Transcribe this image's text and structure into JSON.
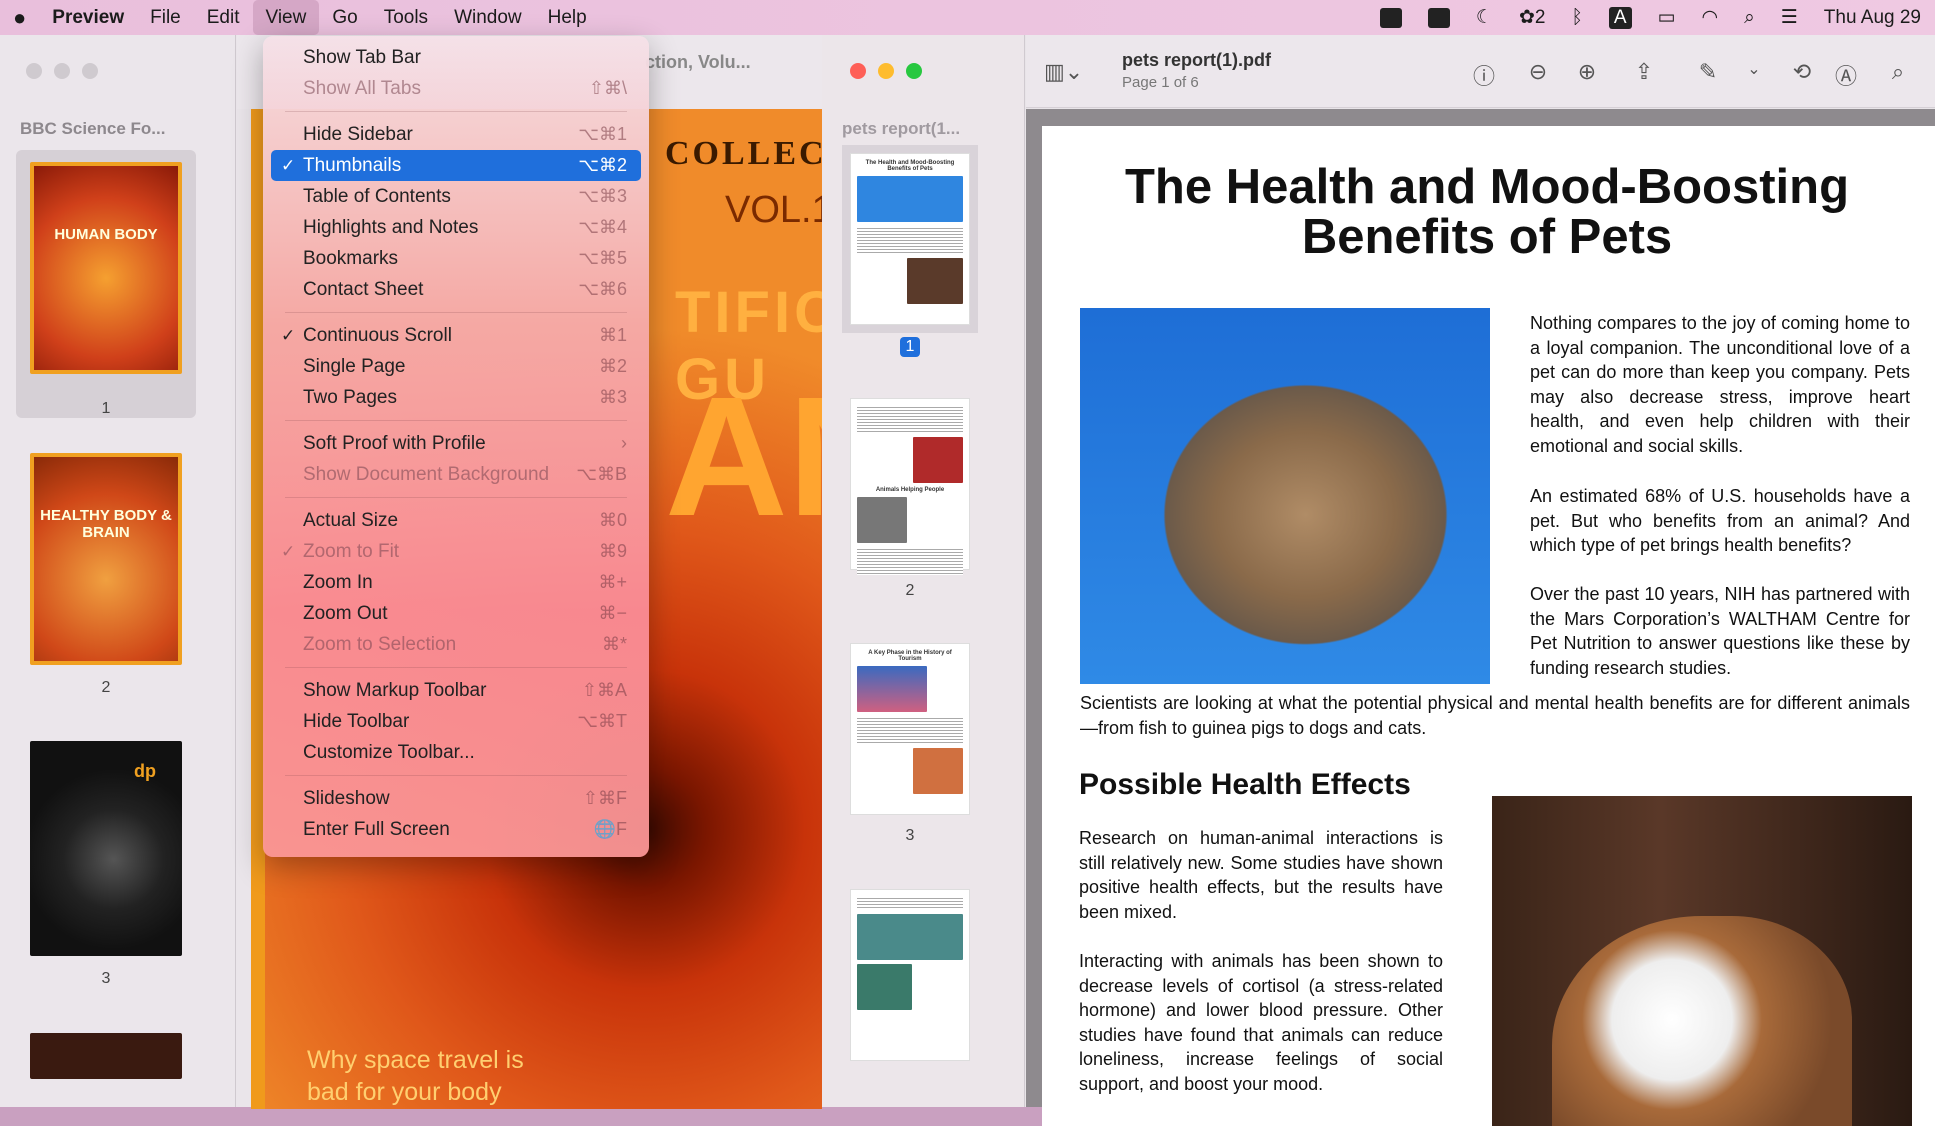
{
  "menubar": {
    "app": "Preview",
    "items": [
      "File",
      "Edit",
      "View",
      "Go",
      "Tools",
      "Window",
      "Help"
    ],
    "status_badge": "2",
    "input_source": "A",
    "date": "Thu Aug 29"
  },
  "window1": {
    "sidebar_title": "BBC Science Fo...",
    "title_fragment": "ction, Volu...",
    "thumbs": [
      {
        "page": "1",
        "label": "HUMAN BODY"
      },
      {
        "page": "2",
        "label": "HEALTHY BODY & BRAIN"
      },
      {
        "page": "3",
        "label": "dp"
      }
    ],
    "cover": {
      "collect": "COLLECT",
      "vol": "VOL.1",
      "big1": "TIFIC GU",
      "big2": "AN",
      "tagline": "Why space travel is bad for your body"
    }
  },
  "view_menu": {
    "items": [
      {
        "label": "Show Tab Bar",
        "shortcut": ""
      },
      {
        "label": "Show All Tabs",
        "shortcut": "⇧⌘\\",
        "disabled": true
      },
      {
        "sep": true
      },
      {
        "label": "Hide Sidebar",
        "shortcut": "⌥⌘1"
      },
      {
        "label": "Thumbnails",
        "shortcut": "⌥⌘2",
        "checked": true,
        "selected": true
      },
      {
        "label": "Table of Contents",
        "shortcut": "⌥⌘3"
      },
      {
        "label": "Highlights and Notes",
        "shortcut": "⌥⌘4"
      },
      {
        "label": "Bookmarks",
        "shortcut": "⌥⌘5"
      },
      {
        "label": "Contact Sheet",
        "shortcut": "⌥⌘6"
      },
      {
        "sep": true
      },
      {
        "label": "Continuous Scroll",
        "shortcut": "⌘1",
        "checked": true
      },
      {
        "label": "Single Page",
        "shortcut": "⌘2"
      },
      {
        "label": "Two Pages",
        "shortcut": "⌘3"
      },
      {
        "sep": true
      },
      {
        "label": "Soft Proof with Profile",
        "shortcut": "›"
      },
      {
        "label": "Show Document Background",
        "shortcut": "⌥⌘B",
        "disabled": true
      },
      {
        "sep": true
      },
      {
        "label": "Actual Size",
        "shortcut": "⌘0"
      },
      {
        "label": "Zoom to Fit",
        "shortcut": "⌘9",
        "checked": true,
        "disabled": true
      },
      {
        "label": "Zoom In",
        "shortcut": "⌘+"
      },
      {
        "label": "Zoom Out",
        "shortcut": "⌘−"
      },
      {
        "label": "Zoom to Selection",
        "shortcut": "⌘*",
        "disabled": true
      },
      {
        "sep": true
      },
      {
        "label": "Show Markup Toolbar",
        "shortcut": "⇧⌘A"
      },
      {
        "label": "Hide Toolbar",
        "shortcut": "⌥⌘T"
      },
      {
        "label": "Customize Toolbar...",
        "shortcut": ""
      },
      {
        "sep": true
      },
      {
        "label": "Slideshow",
        "shortcut": "⇧⌘F"
      },
      {
        "label": "Enter Full Screen",
        "shortcut": "🌐F"
      }
    ]
  },
  "window2": {
    "sidebar_title": "pets report(1...",
    "filename": "pets report(1).pdf",
    "page_info": "Page 1 of 6",
    "thumbs": [
      {
        "page": "1",
        "heading": "The Health and Mood-Boosting Benefits of Pets"
      },
      {
        "page": "2",
        "heading": "Animals Helping People"
      },
      {
        "page": "3",
        "heading": "A Key Phase in the History of Tourism"
      },
      {
        "page": "",
        "heading": ""
      }
    ]
  },
  "document": {
    "title": "The Health and Mood-Boosting Benefits of Pets",
    "p1": "Nothing compares to the joy of coming home to a loyal companion. The unconditional love of a pet can do more than keep you company. Pets may also decrease stress, improve heart health, and even help children with their emotional and social skills.",
    "p2": "An estimated 68% of U.S. households have a pet. But who benefits from an animal? And which type of pet brings health benefits?",
    "p3": "Over the past 10 years, NIH has partnered with the Mars Corporation’s WALTHAM Centre for Pet Nutrition to answer questions like these by funding research studies.",
    "p4": "Scientists are looking at what the potential physical and mental health benefits are for different animals—from fish to guinea pigs to dogs and cats.",
    "h2": "Possible Health Effects",
    "p5": "Research on human-animal interactions is still relatively new. Some studies have shown positive health effects, but the results have been mixed.",
    "p6": "Interacting with animals has been shown to decrease levels of cortisol (a stress-related hormone) and lower blood pressure. Other studies have found that animals can reduce loneliness, increase feelings of social support, and boost your mood."
  }
}
